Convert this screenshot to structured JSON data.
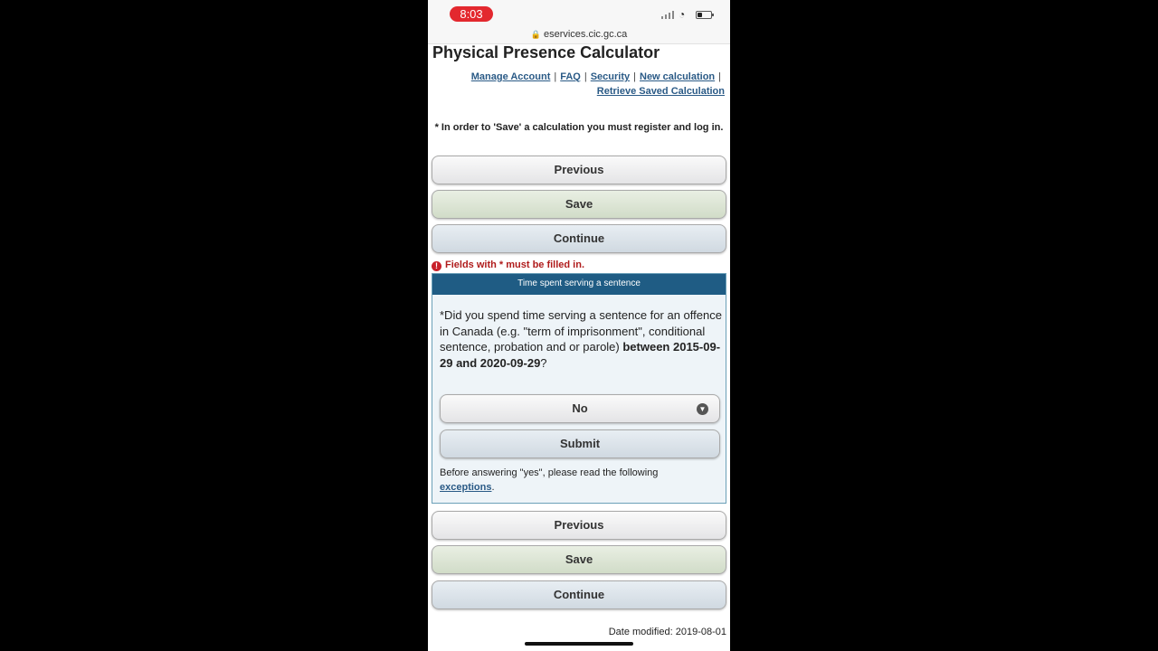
{
  "status_bar": {
    "time": "8:03",
    "wifi_icon": "wifi-icon",
    "battery_level": 0.3
  },
  "browser": {
    "url": "eservices.cic.gc.ca"
  },
  "header": {
    "title": "Physical Presence Calculator",
    "links": [
      "Manage Account",
      "FAQ",
      "Security",
      "New calculation",
      "Retrieve Saved Calculation"
    ]
  },
  "notice": "* In order to 'Save' a calculation you must register and log in.",
  "nav_top": {
    "previous": "Previous",
    "save": "Save",
    "continue": "Continue"
  },
  "required_msg": "Fields with * must be filled in.",
  "panel": {
    "header": "Time spent serving a sentence",
    "question_prefix": "*Did you spend time serving a sentence for an offence in Canada (e.g. \"term of imprisonment\", conditional sentence, probation and or parole) ",
    "question_bold": "between 2015-09-29 and 2020-09-29",
    "question_suffix": "?",
    "select_value": "No",
    "submit_label": "Submit",
    "note_prefix": "Before answering \"yes\", please read the following ",
    "note_link": "exceptions",
    "note_suffix": "."
  },
  "nav_bottom": {
    "previous": "Previous",
    "save": "Save",
    "continue": "Continue"
  },
  "footer": {
    "date_modified_label": "Date modified:",
    "date_modified_value": "2019-08-01"
  },
  "colors": {
    "panel_header": "#1f5c84",
    "link": "#2a5a86",
    "error": "#b01c1c",
    "time_pill": "#e3282e"
  }
}
